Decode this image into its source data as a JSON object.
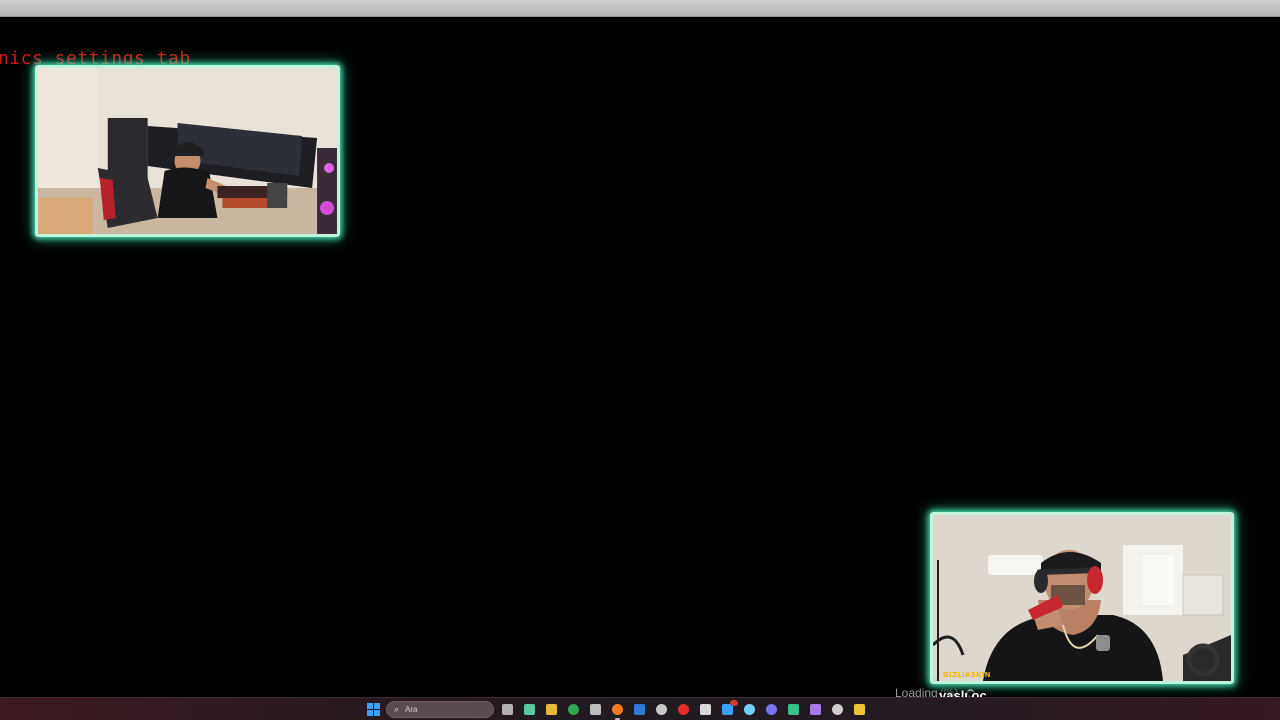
{
  "background_text": "nics settings tab",
  "cameras": {
    "room_cam": {
      "label": "room-camera"
    },
    "face_cam": {
      "name_tag": "GIZLIASKIN"
    }
  },
  "overlay": {
    "loading_text": "Loading",
    "loading_pct": "(%)",
    "caption": "yaşlı oç"
  },
  "taskbar": {
    "search_placeholder": "Ara",
    "apps": [
      {
        "name": "start-icon",
        "color": "#3aa0ff"
      },
      {
        "name": "task-view-icon",
        "color": "#b0b0b0"
      },
      {
        "name": "copilot-icon",
        "color": "#5ac8a0"
      },
      {
        "name": "folder-icon",
        "color": "#e8b73a"
      },
      {
        "name": "chrome-icon",
        "color": "#2fa84f"
      },
      {
        "name": "store-icon",
        "color": "#bdbdbd"
      },
      {
        "name": "firefox-icon",
        "color": "#ff7a1a"
      },
      {
        "name": "outlook-icon",
        "color": "#2b7cd3"
      },
      {
        "name": "steam-icon",
        "color": "#c9c9c9"
      },
      {
        "name": "youtube-music-icon",
        "color": "#e52d27"
      },
      {
        "name": "settings-gear-icon",
        "color": "#d9d9d9"
      },
      {
        "name": "chat-icon",
        "color": "#3aa0ff"
      },
      {
        "name": "network-app-icon",
        "color": "#6fd0ff"
      },
      {
        "name": "discord-icon",
        "color": "#7a74f0"
      },
      {
        "name": "terminal-icon",
        "color": "#35c48a"
      },
      {
        "name": "obs-icon",
        "color": "#a77be6"
      },
      {
        "name": "camera-app-icon",
        "color": "#cfcfcf"
      },
      {
        "name": "archive-icon",
        "color": "#f1c232"
      }
    ]
  }
}
